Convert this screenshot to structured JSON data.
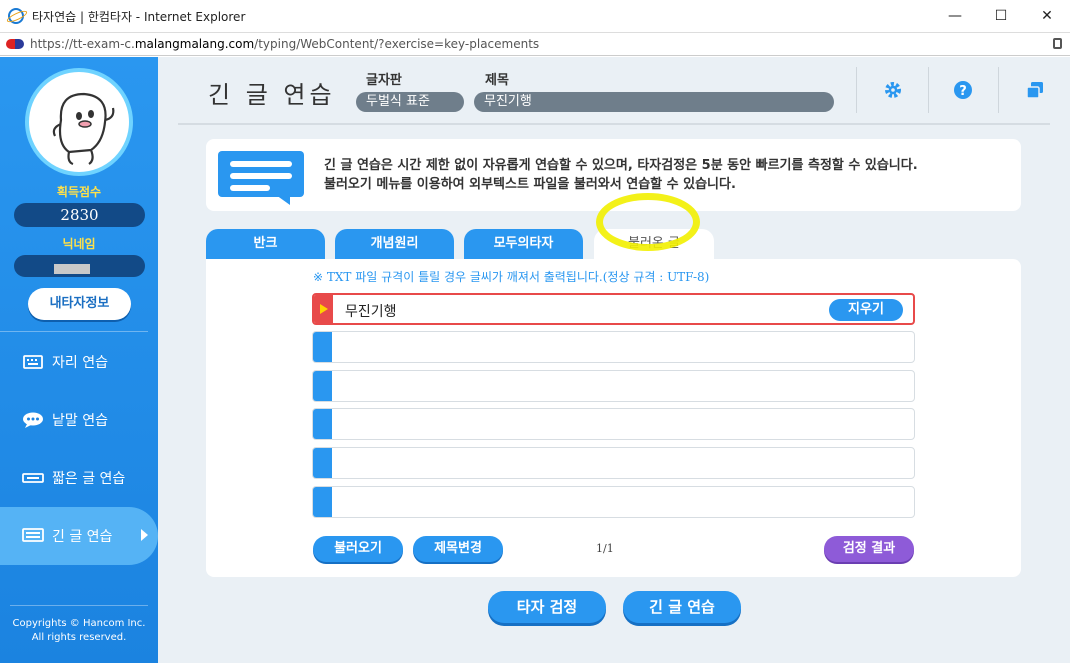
{
  "window": {
    "title": "타자연습 | 한컴타자 - Internet Explorer",
    "controls": {
      "minimize": "—",
      "maximize": "☐",
      "close": "✕"
    }
  },
  "address": {
    "url_prefix": "https://tt-exam-c.",
    "url_domain": "malangmalang.com",
    "url_suffix": "/typing/WebContent/?exercise=key-placements"
  },
  "sidebar": {
    "score_label": "획득점수",
    "score_value": "2830",
    "nickname_label": "닉네임",
    "myinfo_button": "내타자정보",
    "items": [
      {
        "label": "자리 연습",
        "icon": "keyboard-icon"
      },
      {
        "label": "낱말 연습",
        "icon": "speech-bubble-icon"
      },
      {
        "label": "짧은 글 연습",
        "icon": "short-text-icon"
      },
      {
        "label": "긴 글 연습",
        "icon": "long-text-icon"
      }
    ],
    "copyright_line1": "Copyrights © Hancom Inc.",
    "copyright_line2": "All rights reserved."
  },
  "header": {
    "title": "긴 글 연습",
    "keyboard_label": "글자판",
    "keyboard_value": "두벌식 표준",
    "subject_label": "제목",
    "subject_value": "무진기행"
  },
  "notice": {
    "line1": "긴 글 연습은 시간 제한 없이 자유롭게 연습할 수 있으며, 타자검정은 5분 동안 빠르기를 측정할 수 있습니다.",
    "line2": "불러오기 메뉴를 이용하여 외부텍스트 파일을 불러와서 연습할 수 있습니다."
  },
  "tabs": [
    {
      "label": "반크"
    },
    {
      "label": "개념원리"
    },
    {
      "label": "모두의타자"
    },
    {
      "label": "불러온 글"
    }
  ],
  "panel": {
    "warning": "※ TXT 파일 규격이 틀릴 경우 글씨가 깨져서 출력됩니다.(정상 규격 : UTF-8)",
    "rows": [
      "무진기행",
      "",
      "",
      "",
      "",
      ""
    ],
    "delete_button": "지우기",
    "load_button": "불러오기",
    "rename_button": "제목변경",
    "pager": "1/1",
    "result_button": "검정 결과"
  },
  "bottom": {
    "test_button": "타자 검정",
    "practice_button": "긴 글 연습"
  }
}
